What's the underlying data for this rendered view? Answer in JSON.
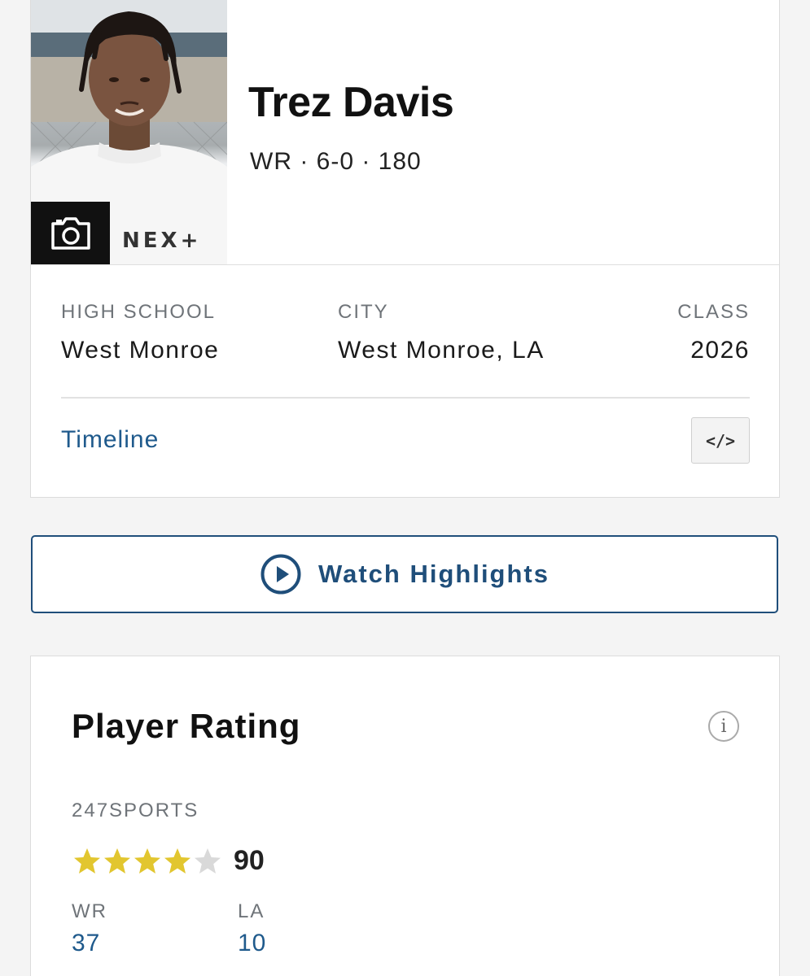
{
  "player": {
    "name": "Trez Davis",
    "meta": "WR · 6-0 · 180",
    "photo_watermark": "NEX+"
  },
  "info": {
    "high_school": {
      "label": "HIGH SCHOOL",
      "value": "West Monroe"
    },
    "city": {
      "label": "CITY",
      "value": "West Monroe, LA"
    },
    "class": {
      "label": "CLASS",
      "value": "2026"
    }
  },
  "links": {
    "timeline": "Timeline",
    "embed": "</>"
  },
  "highlights": {
    "label": "Watch Highlights"
  },
  "rating": {
    "title": "Player Rating",
    "info_icon": "i",
    "source": "247SPORTS",
    "stars": 4,
    "stars_max": 5,
    "score": "90",
    "position_rank": {
      "label": "WR",
      "value": "37"
    },
    "state_rank": {
      "label": "LA",
      "value": "10"
    }
  },
  "colors": {
    "link_blue": "#1f5a8c",
    "button_navy": "#1f4e7a",
    "star_gold": "#e2c62f",
    "star_empty": "#d9d9d9"
  },
  "icons": {
    "camera": "camera-icon",
    "play": "play-circle-icon",
    "info": "info-icon",
    "embed": "code-embed-icon",
    "star": "star-icon"
  }
}
